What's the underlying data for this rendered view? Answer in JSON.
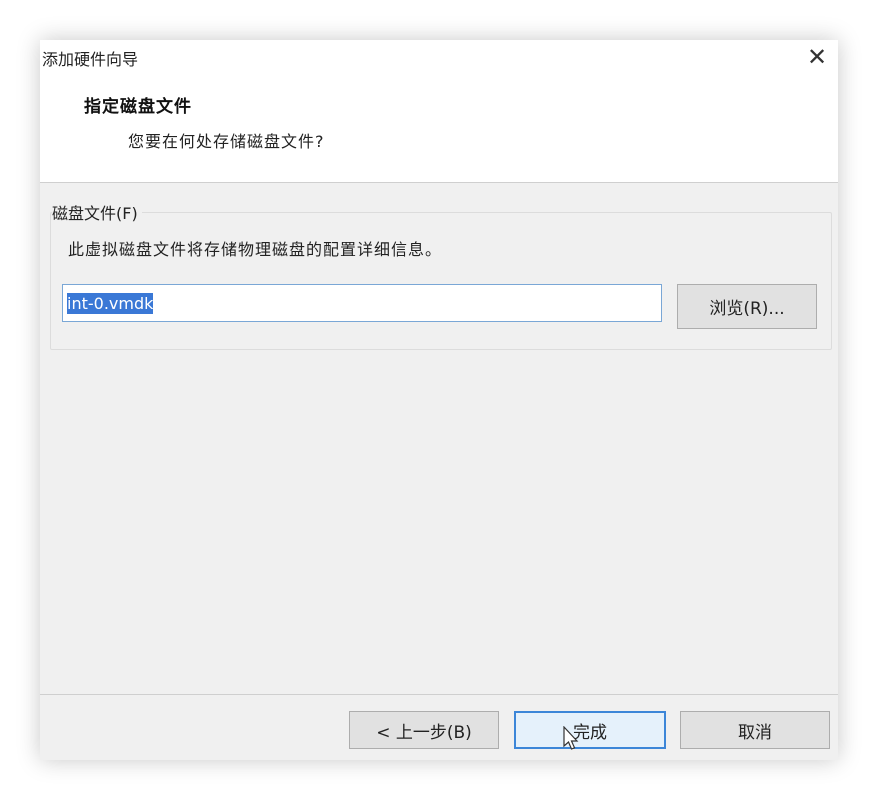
{
  "window": {
    "title": "添加硬件向导",
    "close_icon": "close-icon"
  },
  "header": {
    "title": "指定磁盘文件",
    "subtitle": "您要在何处存储磁盘文件?"
  },
  "disk_file_group": {
    "legend": "磁盘文件(F)",
    "description": "此虚拟磁盘文件将存储物理磁盘的配置详细信息。",
    "input_value": "int-0.vmdk",
    "browse_label": "浏览(R)..."
  },
  "footer": {
    "back_label": "< 上一步(B)",
    "finish_label": "完成",
    "cancel_label": "取消"
  },
  "colors": {
    "selection": "#3a78d6",
    "focus_border": "#3c86d8",
    "dialog_bg": "#f0f0f0"
  }
}
